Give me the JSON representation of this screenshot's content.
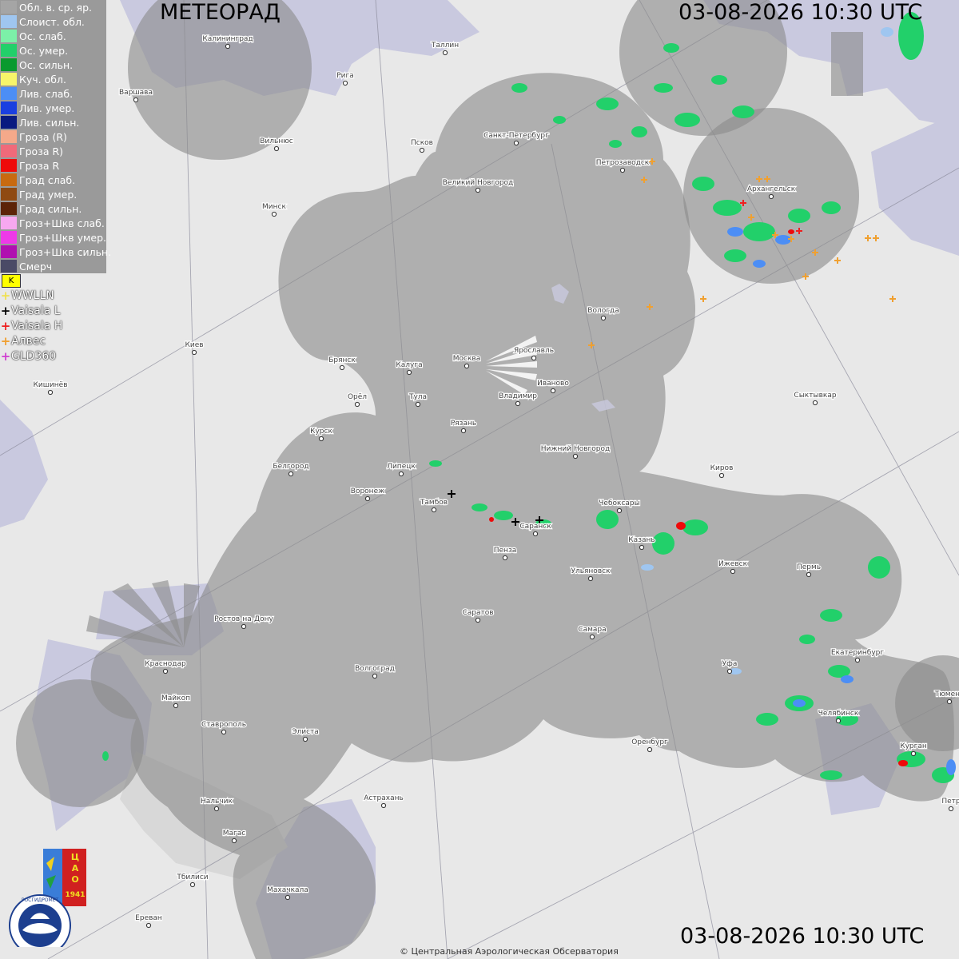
{
  "header": {
    "title": "МЕТЕОРАД",
    "datetime_top": "03-08-2026  10:30 UTC",
    "datetime_bottom": "03-08-2026  10:30 UTC"
  },
  "legend": [
    {
      "label": "Обл. в. ср. яр.",
      "color": "#a5a5a5"
    },
    {
      "label": "Слоист. обл.",
      "color": "#9fc6f0"
    },
    {
      "label": "Ос. слаб.",
      "color": "#7cf0a8"
    },
    {
      "label": "Ос. умер.",
      "color": "#22d06a"
    },
    {
      "label": "Ос. сильн.",
      "color": "#099a2e"
    },
    {
      "label": "Куч. обл.",
      "color": "#f7f56a"
    },
    {
      "label": "Лив. слаб.",
      "color": "#4c8ef5"
    },
    {
      "label": "Лив. умер.",
      "color": "#1a3fe0"
    },
    {
      "label": "Лив. сильн.",
      "color": "#081a80"
    },
    {
      "label": "Гроза (R)",
      "color": "#f5a98a"
    },
    {
      "label": "Гроза R)",
      "color": "#f06a7a"
    },
    {
      "label": "Гроза R",
      "color": "#ee0a0a"
    },
    {
      "label": "Град слаб.",
      "color": "#c86a10"
    },
    {
      "label": "Град умер.",
      "color": "#8f4a12"
    },
    {
      "label": "Град сильн.",
      "color": "#5c2408"
    },
    {
      "label": "Гроз+Шкв слаб.",
      "color": "#f7a8f0"
    },
    {
      "label": "Гроз+Шкв умер.",
      "color": "#ee3ae8"
    },
    {
      "label": "Гроз+Шкв сильн.",
      "color": "#b010b0"
    },
    {
      "label": "Смерч",
      "color": "#4a4a66"
    }
  ],
  "lightning_sources": [
    {
      "label": "WWLLN",
      "color": "#f0e050"
    },
    {
      "label": "Vaisala L",
      "color": "#000000"
    },
    {
      "label": "Vaisala H",
      "color": "#ee2020"
    },
    {
      "label": "Алвес",
      "color": "#f0a030"
    },
    {
      "label": "GLD360",
      "color": "#d040d0"
    }
  ],
  "flag_symbol": "K",
  "cities": [
    {
      "name": "Калининград"
    },
    {
      "name": "Таллин"
    },
    {
      "name": "Рига"
    },
    {
      "name": "Варшава"
    },
    {
      "name": "Вильнюс"
    },
    {
      "name": "Псков"
    },
    {
      "name": "Санкт-Петербург"
    },
    {
      "name": "Петрозаводск"
    },
    {
      "name": "Архангельск"
    },
    {
      "name": "Великий Новгород"
    },
    {
      "name": "Минск"
    },
    {
      "name": "Вологда"
    },
    {
      "name": "Киев"
    },
    {
      "name": "Брянск"
    },
    {
      "name": "Калуга"
    },
    {
      "name": "Москва"
    },
    {
      "name": "Ярославль"
    },
    {
      "name": "Кишинёв"
    },
    {
      "name": "Орёл"
    },
    {
      "name": "Тула"
    },
    {
      "name": "Иваново"
    },
    {
      "name": "Владимир"
    },
    {
      "name": "Сыктывкар"
    },
    {
      "name": "Рязань"
    },
    {
      "name": "Курск"
    },
    {
      "name": "Нижний Новгород"
    },
    {
      "name": "Белгород"
    },
    {
      "name": "Липецк"
    },
    {
      "name": "Киров"
    },
    {
      "name": "Воронеж"
    },
    {
      "name": "Тамбов"
    },
    {
      "name": "Чебоксары"
    },
    {
      "name": "Саранск"
    },
    {
      "name": "Казань"
    },
    {
      "name": "Пенза"
    },
    {
      "name": "Ижевск"
    },
    {
      "name": "Пермь"
    },
    {
      "name": "Ульяновск"
    },
    {
      "name": "Ростов-на-Дону"
    },
    {
      "name": "Саратов"
    },
    {
      "name": "Самара"
    },
    {
      "name": "Екатеринбург"
    },
    {
      "name": "Краснодар"
    },
    {
      "name": "Волгоград"
    },
    {
      "name": "Уфа"
    },
    {
      "name": "Майкоп"
    },
    {
      "name": "Тюмень"
    },
    {
      "name": "Челябинск"
    },
    {
      "name": "Ставрополь"
    },
    {
      "name": "Элиста"
    },
    {
      "name": "Оренбург"
    },
    {
      "name": "Курган"
    },
    {
      "name": "Астрахань"
    },
    {
      "name": "Нальчик"
    },
    {
      "name": "Петр"
    },
    {
      "name": "Магас"
    },
    {
      "name": "Тбилиси"
    },
    {
      "name": "Махачкала"
    },
    {
      "name": "Ереван"
    }
  ],
  "logo": {
    "org_ru": "РОСГИДРОМЕТ",
    "org_en": "ROSHYDROMET",
    "cao": "ЦАО",
    "year": "1941"
  },
  "copyright": "© Центральная Аэрологическая Обсерватория"
}
